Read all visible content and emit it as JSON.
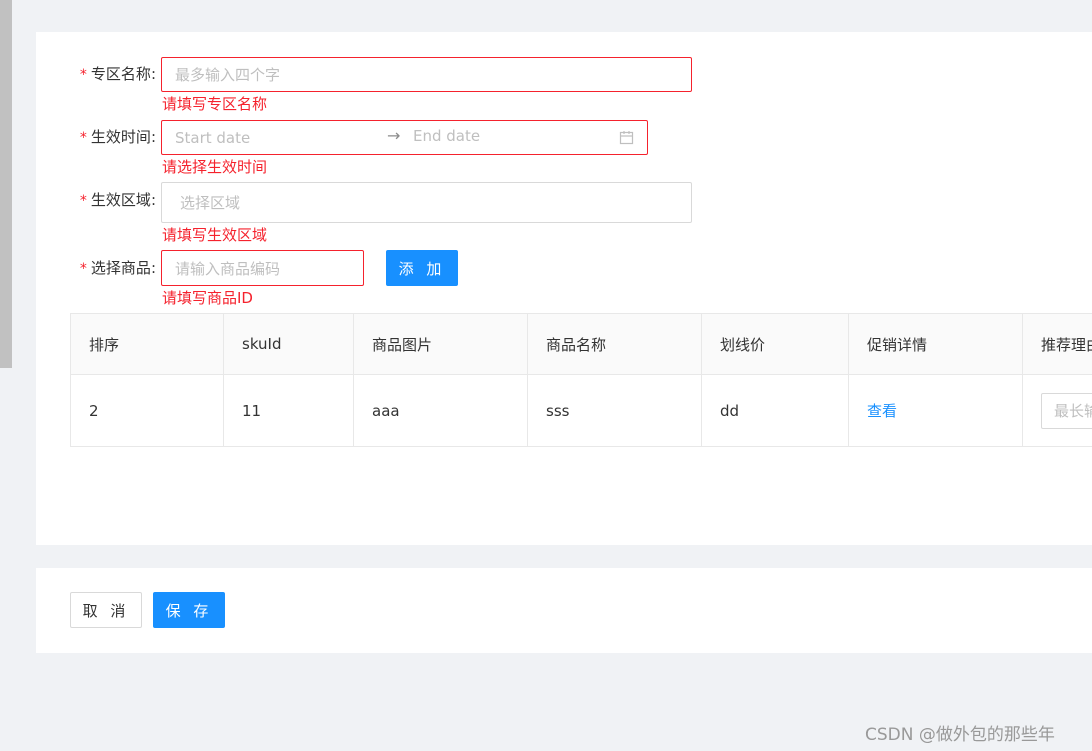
{
  "form": {
    "zone_name": {
      "label": "专区名称",
      "placeholder": "最多输入四个字",
      "error": "请填写专区名称"
    },
    "effective_time": {
      "label": "生效时间",
      "start_placeholder": "Start date",
      "separator": "→",
      "end_placeholder": "End date",
      "error": "请选择生效时间"
    },
    "effective_region": {
      "label": "生效区域",
      "placeholder": "选择区域",
      "error": "请填写生效区域"
    },
    "select_product": {
      "label": "选择商品",
      "placeholder": "请输入商品编码",
      "add_button": "添 加",
      "error": "请填写商品ID"
    },
    "required_mark": "*",
    "colon": ":"
  },
  "table": {
    "columns": [
      "排序",
      "skuId",
      "商品图片",
      "商品名称",
      "划线价",
      "促销详情",
      "推荐理由"
    ],
    "rows": [
      {
        "order": "2",
        "sku_id": "11",
        "image": "aaa",
        "name": "sss",
        "strike_price": "dd",
        "promo_detail": "查看",
        "reason_placeholder": "最长输入"
      }
    ]
  },
  "actions": {
    "cancel": "取 消",
    "save": "保 存"
  },
  "watermark": "CSDN @做外包的那些年",
  "colors": {
    "primary": "#1890ff",
    "error": "#f5222d",
    "border": "#d9d9d9",
    "background": "#f0f2f5"
  }
}
